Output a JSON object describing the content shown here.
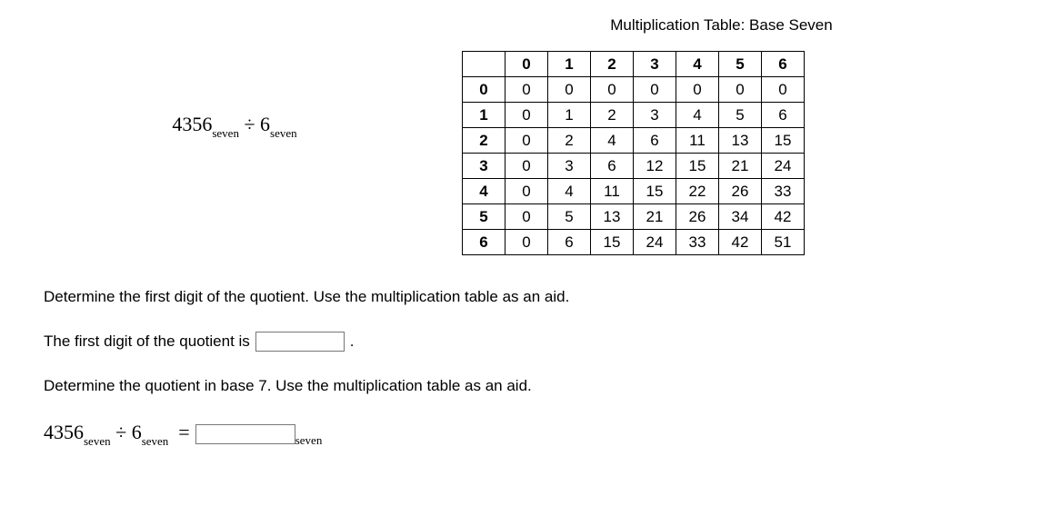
{
  "expression": {
    "dividend": "4356",
    "base_word": "seven",
    "operator": "÷",
    "divisor": "6"
  },
  "table": {
    "caption": "Multiplication Table: Base Seven",
    "col_headers": [
      "0",
      "1",
      "2",
      "3",
      "4",
      "5",
      "6"
    ],
    "row_headers": [
      "0",
      "1",
      "2",
      "3",
      "4",
      "5",
      "6"
    ],
    "rows": [
      [
        "0",
        "0",
        "0",
        "0",
        "0",
        "0",
        "0"
      ],
      [
        "0",
        "1",
        "2",
        "3",
        "4",
        "5",
        "6"
      ],
      [
        "0",
        "2",
        "4",
        "6",
        "11",
        "13",
        "15"
      ],
      [
        "0",
        "3",
        "6",
        "12",
        "15",
        "21",
        "24"
      ],
      [
        "0",
        "4",
        "11",
        "15",
        "22",
        "26",
        "33"
      ],
      [
        "0",
        "5",
        "13",
        "21",
        "26",
        "34",
        "42"
      ],
      [
        "0",
        "6",
        "15",
        "24",
        "33",
        "42",
        "51"
      ]
    ]
  },
  "prompt1": "Determine the first digit of the quotient. Use the multiplication table as an aid.",
  "labels": {
    "first_digit_pre": "The first digit of the quotient is",
    "period": ".",
    "equals": "="
  },
  "prompt2": "Determine the quotient in base 7. Use the multiplication table as an aid.",
  "inputs": {
    "first_digit_value": "",
    "quotient_value": "",
    "unit": "seven"
  }
}
